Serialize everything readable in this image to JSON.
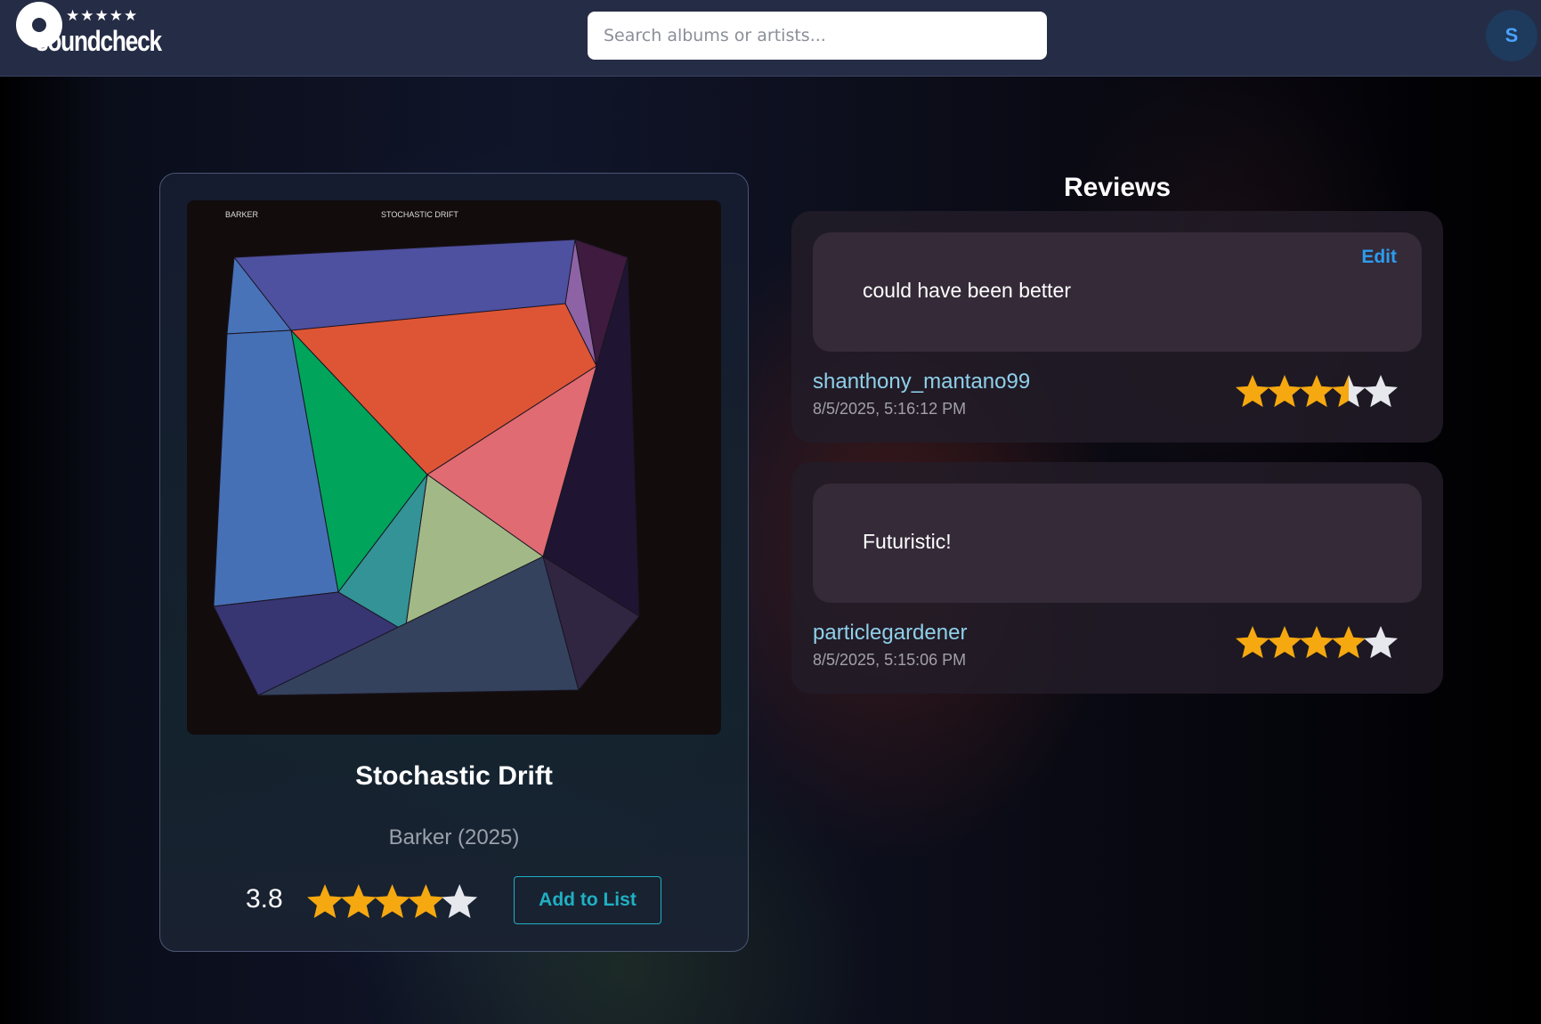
{
  "header": {
    "logo_word": "soundcheck",
    "logo_stars": "★★★★★",
    "search_placeholder": "Search albums or artists...",
    "avatar_initial": "S"
  },
  "album": {
    "cover_artist_text": "BARKER",
    "cover_title_text": "STOCHASTIC DRIFT",
    "title": "Stochastic Drift",
    "artist_year": "Barker (2025)",
    "average_rating_label": "3.8",
    "average_rating": 3.8,
    "add_button_label": "Add to List"
  },
  "reviews": {
    "heading": "Reviews",
    "items": [
      {
        "text": "could have been better",
        "edit_label": "Edit",
        "username": "shanthony_mantano99",
        "date": "8/5/2025, 5:16:12 PM",
        "rating": 3.5
      },
      {
        "text": "Futuristic!",
        "username": "particlegardener",
        "date": "8/5/2025, 5:15:06 PM",
        "rating": 4
      }
    ]
  },
  "colors": {
    "star_filled": "#f5a810",
    "star_empty": "#e6e8ee",
    "accent": "#1fb0c4",
    "edit": "#2d9cf0"
  }
}
